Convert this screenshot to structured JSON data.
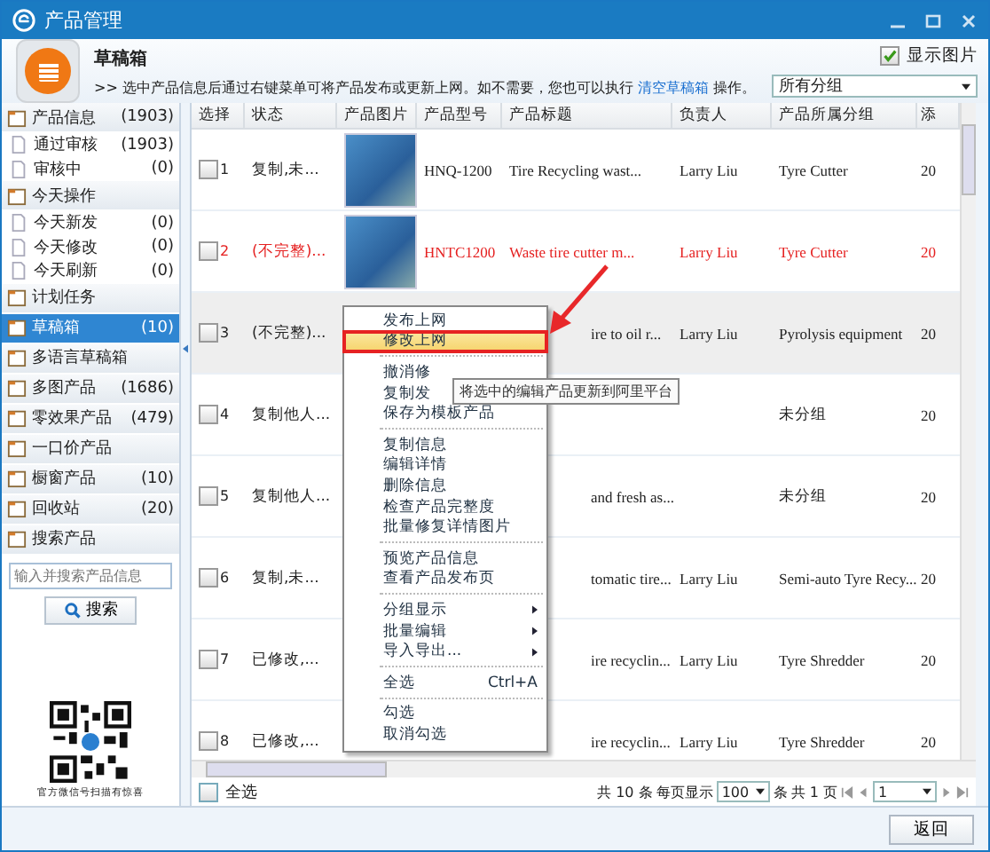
{
  "window": {
    "title": "产品管理"
  },
  "header": {
    "title": "草稿箱",
    "description_before": ">> 选中产品信息后通过右键菜单可将产品发布或更新上网。如不需要，您也可以执行",
    "link": "清空草稿箱",
    "description_after": "操作。",
    "show_images": {
      "label": "显示图片",
      "checked": true
    },
    "group_filter": "所有分组"
  },
  "sidebar": {
    "items": [
      {
        "kind": "header",
        "label": "产品信息",
        "count": "(1903)",
        "selected": false
      },
      {
        "kind": "sub",
        "label": "通过审核",
        "count": "(1903)",
        "selected": false
      },
      {
        "kind": "sub",
        "label": "审核中",
        "count": "(0)",
        "selected": false
      },
      {
        "kind": "header",
        "label": "今天操作",
        "selected": false
      },
      {
        "kind": "sub",
        "label": "今天新发",
        "count": "(0)",
        "selected": false
      },
      {
        "kind": "sub",
        "label": "今天修改",
        "count": "(0)",
        "selected": false
      },
      {
        "kind": "sub",
        "label": "今天刷新",
        "count": "(0)",
        "selected": false
      },
      {
        "kind": "header",
        "label": "计划任务",
        "selected": false
      },
      {
        "kind": "header",
        "label": "草稿箱",
        "count": "(10)",
        "selected": true
      },
      {
        "kind": "header",
        "label": "多语言草稿箱",
        "selected": false
      },
      {
        "kind": "header",
        "label": "多图产品",
        "count": "(1686)",
        "selected": false
      },
      {
        "kind": "header",
        "label": "零效果产品",
        "count": "(479)",
        "selected": false
      },
      {
        "kind": "header",
        "label": "一口价产品",
        "selected": false
      },
      {
        "kind": "header",
        "label": "橱窗产品",
        "count": "(10)",
        "selected": false
      },
      {
        "kind": "header",
        "label": "回收站",
        "count": "(20)",
        "selected": false
      },
      {
        "kind": "header",
        "label": "搜索产品",
        "selected": false
      }
    ],
    "search": {
      "placeholder": "输入并搜索产品信息",
      "button": "搜索"
    },
    "qr_caption": "官方微信号扫描有惊喜"
  },
  "table": {
    "columns": [
      "选择",
      "状态",
      "产品图片",
      "产品型号",
      "产品标题",
      "负责人",
      "产品所属分组",
      "添"
    ],
    "rows": [
      {
        "number": "1",
        "checked": false,
        "selected": false,
        "error": false,
        "status": "复制,未...",
        "photo": true,
        "model": "HNQ-1200",
        "title": "Tire Recycling wast...",
        "owner": "Larry Liu",
        "group": "Tyre Cutter",
        "date": "20"
      },
      {
        "number": "2",
        "checked": false,
        "selected": false,
        "error": true,
        "status": "(不完整)...",
        "photo": true,
        "model": "HNTC1200",
        "title": "Waste tire cutter m...",
        "owner": "Larry Liu",
        "group": "Tyre Cutter",
        "date": "20"
      },
      {
        "number": "3",
        "checked": false,
        "selected": true,
        "error": false,
        "status": "(不完整)...",
        "title": "ire to oil r...",
        "owner": "Larry Liu",
        "group": "Pyrolysis equipment",
        "date": "20"
      },
      {
        "number": "4",
        "checked": false,
        "selected": false,
        "error": false,
        "status": "复制他人...",
        "group": "未分组",
        "date": "20"
      },
      {
        "number": "5",
        "checked": false,
        "selected": false,
        "error": false,
        "status": "复制他人...",
        "title": "and fresh as...",
        "group": "未分组",
        "date": "20"
      },
      {
        "number": "6",
        "checked": false,
        "selected": false,
        "error": false,
        "status": "复制,未...",
        "title": "tomatic tire...",
        "owner": "Larry Liu",
        "group": "Semi-auto Tyre Recy...",
        "date": "20"
      },
      {
        "number": "7",
        "checked": false,
        "selected": false,
        "error": false,
        "status": "已修改,...",
        "title": "ire recyclin...",
        "owner": "Larry Liu",
        "group": "Tyre Shredder",
        "date": "20"
      },
      {
        "number": "8",
        "checked": false,
        "selected": false,
        "error": false,
        "status": "已修改,...",
        "title": "ire recyclin...",
        "owner": "Larry Liu",
        "group": "Tyre Shredder",
        "date": "20"
      }
    ]
  },
  "footer": {
    "select_all": {
      "label": "全选",
      "checked": false
    },
    "total": "共 10 条",
    "per_page_label": "每页显示",
    "per_page": "100",
    "unit": "条",
    "pages": "共 1 页",
    "page": "1"
  },
  "context_menu": {
    "groups": [
      [
        {
          "label": "发布上网",
          "selected": false
        },
        {
          "label": "修改上网",
          "selected": true
        }
      ],
      [
        {
          "label": "撤消修",
          "selected": false
        },
        {
          "label": "复制发",
          "selected": false
        },
        {
          "label": "保存为模板产品",
          "selected": false
        }
      ],
      [
        {
          "label": "复制信息",
          "selected": false
        },
        {
          "label": "编辑详情",
          "selected": false
        },
        {
          "label": "删除信息",
          "selected": false
        },
        {
          "label": "检查产品完整度",
          "selected": false
        },
        {
          "label": "批量修复详情图片",
          "selected": false
        }
      ],
      [
        {
          "label": "预览产品信息",
          "selected": false
        },
        {
          "label": "查看产品发布页",
          "selected": false
        }
      ],
      [
        {
          "label": "分组显示",
          "submenu": true,
          "selected": false
        },
        {
          "label": "批量编辑",
          "submenu": true,
          "selected": false
        },
        {
          "label": "导入导出...",
          "submenu": true,
          "selected": false
        }
      ],
      [
        {
          "label": "全选",
          "shortcut": "Ctrl+A",
          "selected": false
        }
      ],
      [
        {
          "label": "勾选",
          "selected": false
        },
        {
          "label": "取消勾选",
          "selected": false
        }
      ]
    ]
  },
  "tooltip": "将选中的编辑产品更新到阿里平台",
  "buttons": [
    "返回"
  ]
}
